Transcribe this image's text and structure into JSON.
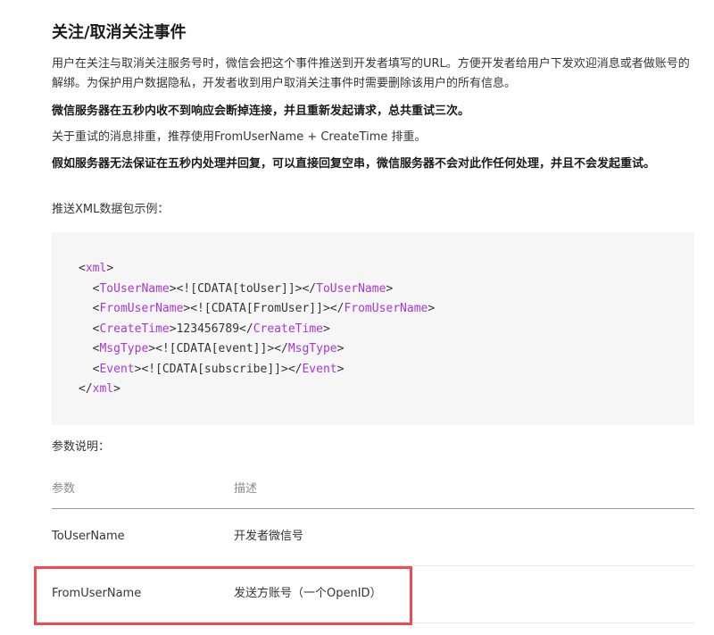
{
  "section": {
    "title": "关注/取消关注事件",
    "paragraphs": [
      "用户在关注与取消关注服务号时，微信会把这个事件推送到开发者填写的URL。方便开发者给用户下发欢迎消息或者做账号的解绑。为保护用户数据隐私，开发者收到用户取消关注事件时需要删除该用户的所有信息。",
      "微信服务器在五秒内收不到响应会断掉连接，并且重新发起请求，总共重试三次。",
      "关于重试的消息排重，推荐使用FromUserName + CreateTime 排重。",
      "假如服务器无法保证在五秒内处理并回复，可以直接回复空串，微信服务器不会对此作任何处理，并且不会发起重试。",
      "推送XML数据包示例："
    ]
  },
  "code": {
    "lines": [
      {
        "indent": "",
        "open": "xml",
        "content": "",
        "close": ""
      },
      {
        "indent": "  ",
        "open": "ToUserName",
        "content": "<![CDATA[toUser]]>",
        "close": "ToUserName"
      },
      {
        "indent": "  ",
        "open": "FromUserName",
        "content": "<![CDATA[FromUser]]>",
        "close": "FromUserName"
      },
      {
        "indent": "  ",
        "open": "CreateTime",
        "content": "123456789",
        "close": "CreateTime"
      },
      {
        "indent": "  ",
        "open": "MsgType",
        "content": "<![CDATA[event]]>",
        "close": "MsgType"
      },
      {
        "indent": "  ",
        "open": "Event",
        "content": "<![CDATA[subscribe]]>",
        "close": "Event"
      },
      {
        "indent": "",
        "open": "",
        "content": "",
        "close": "xml"
      }
    ]
  },
  "params": {
    "title": "参数说明：",
    "headers": [
      "参数",
      "描述"
    ],
    "rows": [
      [
        "ToUserName",
        "开发者微信号"
      ],
      [
        "FromUserName",
        "发送方账号（一个OpenID）"
      ]
    ]
  },
  "colors": {
    "tag": "#a838d6",
    "highlight": "#ef4b50",
    "code_bg": "#f6f6f6"
  }
}
